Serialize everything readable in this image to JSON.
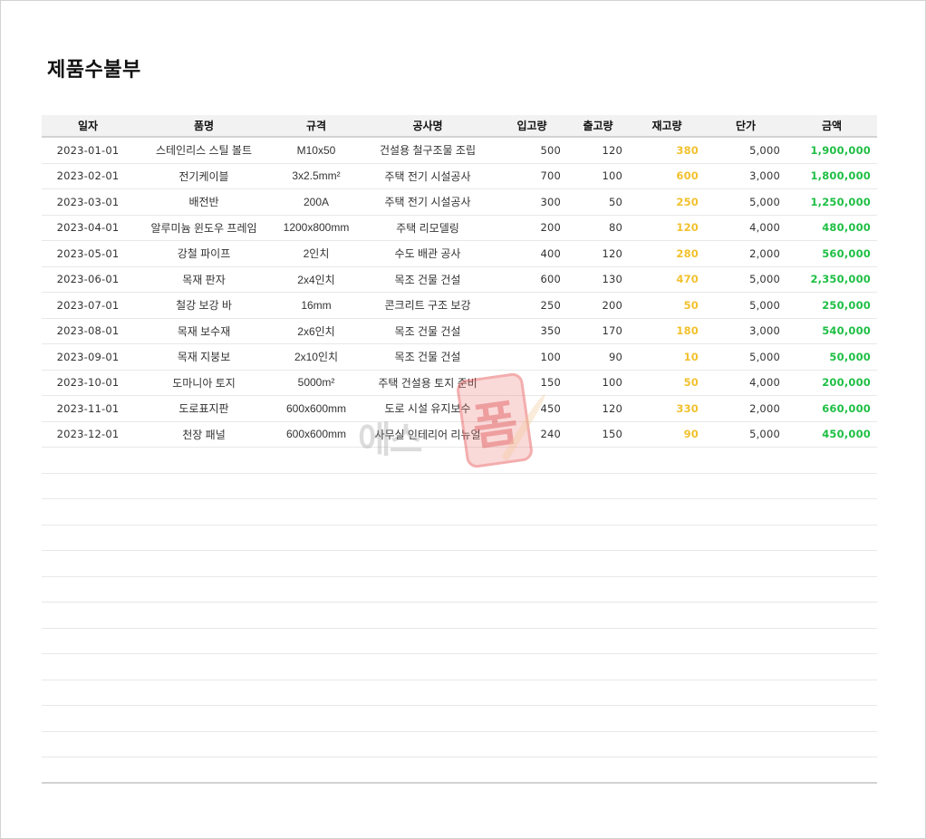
{
  "title": "제품수불부",
  "columns": [
    "일자",
    "품명",
    "규격",
    "공사명",
    "입고량",
    "출고량",
    "재고량",
    "단가",
    "금액"
  ],
  "rows": [
    {
      "date": "2023-01-01",
      "product": "스테인리스 스틸 볼트",
      "spec": "M10x50",
      "project": "건설용 철구조물 조립",
      "in": "500",
      "out": "120",
      "stock": "380",
      "price": "5,000",
      "amount": "1,900,000"
    },
    {
      "date": "2023-02-01",
      "product": "전기케이블",
      "spec": "3x2.5mm²",
      "project": "주택 전기 시설공사",
      "in": "700",
      "out": "100",
      "stock": "600",
      "price": "3,000",
      "amount": "1,800,000"
    },
    {
      "date": "2023-03-01",
      "product": "배전반",
      "spec": "200A",
      "project": "주택 전기 시설공사",
      "in": "300",
      "out": "50",
      "stock": "250",
      "price": "5,000",
      "amount": "1,250,000"
    },
    {
      "date": "2023-04-01",
      "product": "알루미늄 윈도우 프레임",
      "spec": "1200x800mm",
      "project": "주택 리모델링",
      "in": "200",
      "out": "80",
      "stock": "120",
      "price": "4,000",
      "amount": "480,000"
    },
    {
      "date": "2023-05-01",
      "product": "강철 파이프",
      "spec": "2인치",
      "project": "수도 배관 공사",
      "in": "400",
      "out": "120",
      "stock": "280",
      "price": "2,000",
      "amount": "560,000"
    },
    {
      "date": "2023-06-01",
      "product": "목재 판자",
      "spec": "2x4인치",
      "project": "목조 건물 건설",
      "in": "600",
      "out": "130",
      "stock": "470",
      "price": "5,000",
      "amount": "2,350,000"
    },
    {
      "date": "2023-07-01",
      "product": "철강 보강 바",
      "spec": "16mm",
      "project": "콘크리트 구조 보강",
      "in": "250",
      "out": "200",
      "stock": "50",
      "price": "5,000",
      "amount": "250,000"
    },
    {
      "date": "2023-08-01",
      "product": "목재 보수재",
      "spec": "2x6인치",
      "project": "목조 건물 건설",
      "in": "350",
      "out": "170",
      "stock": "180",
      "price": "3,000",
      "amount": "540,000"
    },
    {
      "date": "2023-09-01",
      "product": "목재 지붕보",
      "spec": "2x10인치",
      "project": "목조 건물 건설",
      "in": "100",
      "out": "90",
      "stock": "10",
      "price": "5,000",
      "amount": "50,000"
    },
    {
      "date": "2023-10-01",
      "product": "도마니아 토지",
      "spec": "5000m²",
      "project": "주택 건설용 토지 준비",
      "in": "150",
      "out": "100",
      "stock": "50",
      "price": "4,000",
      "amount": "200,000"
    },
    {
      "date": "2023-11-01",
      "product": "도로표지판",
      "spec": "600x600mm",
      "project": "도로 시설 유지보수",
      "in": "450",
      "out": "120",
      "stock": "330",
      "price": "2,000",
      "amount": "660,000"
    },
    {
      "date": "2023-12-01",
      "product": "천장 패널",
      "spec": "600x600mm",
      "project": "사무실 인테리어 리뉴얼",
      "in": "240",
      "out": "150",
      "stock": "90",
      "price": "5,000",
      "amount": "450,000"
    }
  ],
  "colors": {
    "stock": "#f2c12e",
    "amount": "#1fbf45"
  },
  "watermark": {
    "text": "에스",
    "glyph": "폼"
  }
}
